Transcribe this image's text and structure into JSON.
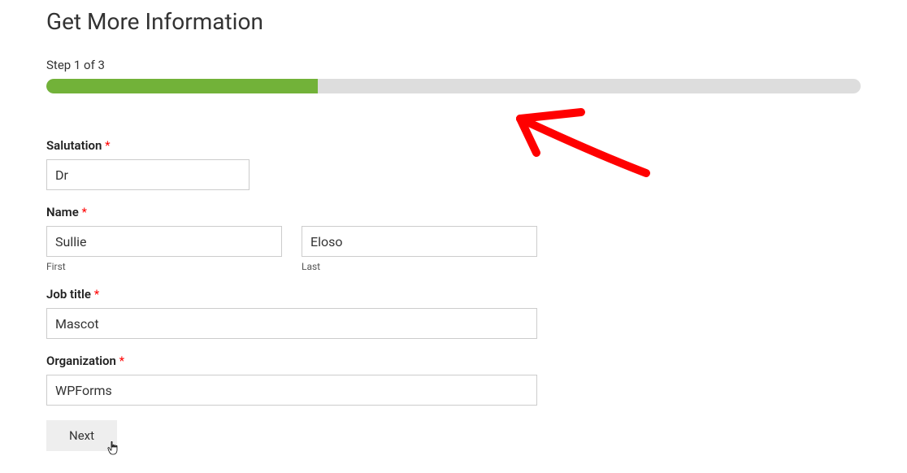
{
  "title": "Get More Information",
  "step_label": "Step 1 of 3",
  "progress_percent": 33.3,
  "fields": {
    "salutation": {
      "label": "Salutation",
      "value": "Dr"
    },
    "name": {
      "label": "Name",
      "first": {
        "value": "Sullie",
        "sublabel": "First"
      },
      "last": {
        "value": "Eloso",
        "sublabel": "Last"
      }
    },
    "job_title": {
      "label": "Job title",
      "value": "Mascot"
    },
    "organization": {
      "label": "Organization",
      "value": "WPForms"
    }
  },
  "required_marker": "*",
  "next_button": "Next"
}
